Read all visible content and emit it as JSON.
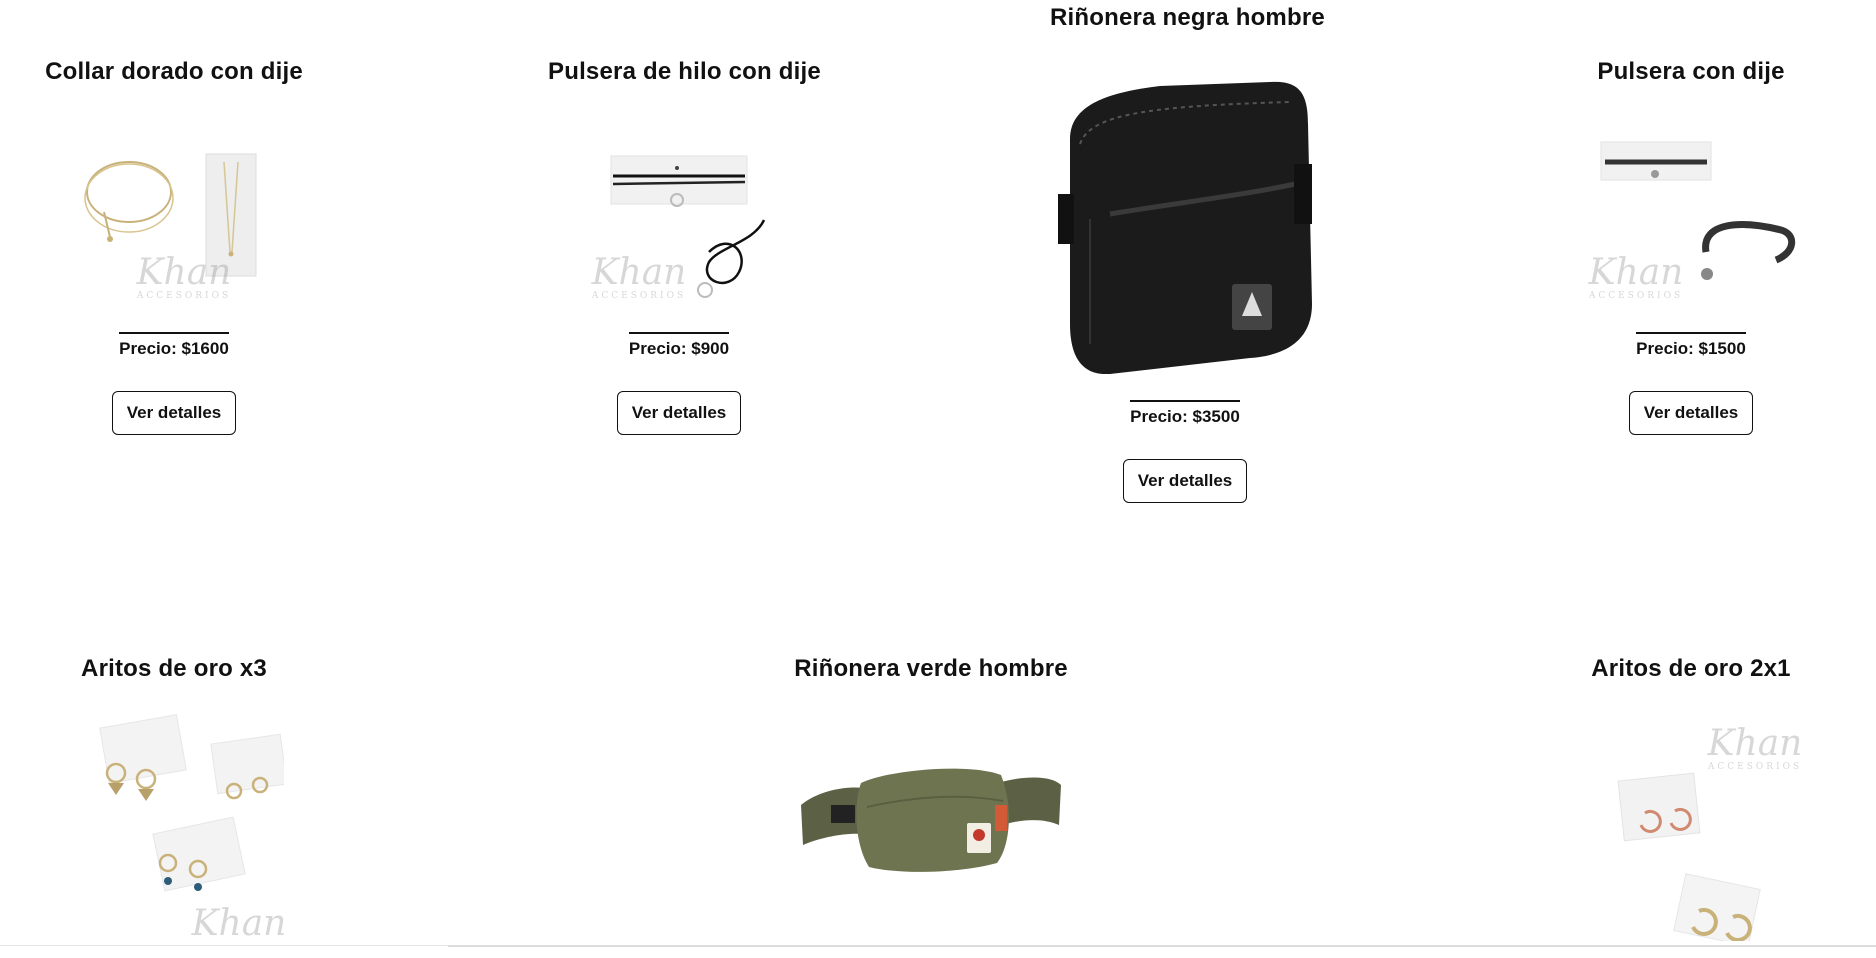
{
  "products": [
    {
      "title": "Collar dorado con dije",
      "price": "Precio: $1600",
      "button": "Ver detalles"
    },
    {
      "title": "Pulsera de hilo con dije",
      "price": "Precio: $900",
      "button": "Ver detalles"
    },
    {
      "title": "Riñonera negra hombre",
      "price": "Precio: $3500",
      "button": "Ver detalles"
    },
    {
      "title": "Pulsera con dije",
      "price": "Precio: $1500",
      "button": "Ver detalles"
    },
    {
      "title": "Aritos de oro x3"
    },
    {
      "title": "Riñonera verde hombre"
    },
    {
      "title": "Aritos de oro 2x1"
    }
  ],
  "watermark": {
    "brand": "Khan",
    "tagline": "ACCESORIOS"
  },
  "colors": {
    "text": "#111111",
    "background": "#ffffff",
    "bag_black": "#1b1b1b",
    "bag_green": "#6f7450",
    "gold": "#c9b27a"
  }
}
